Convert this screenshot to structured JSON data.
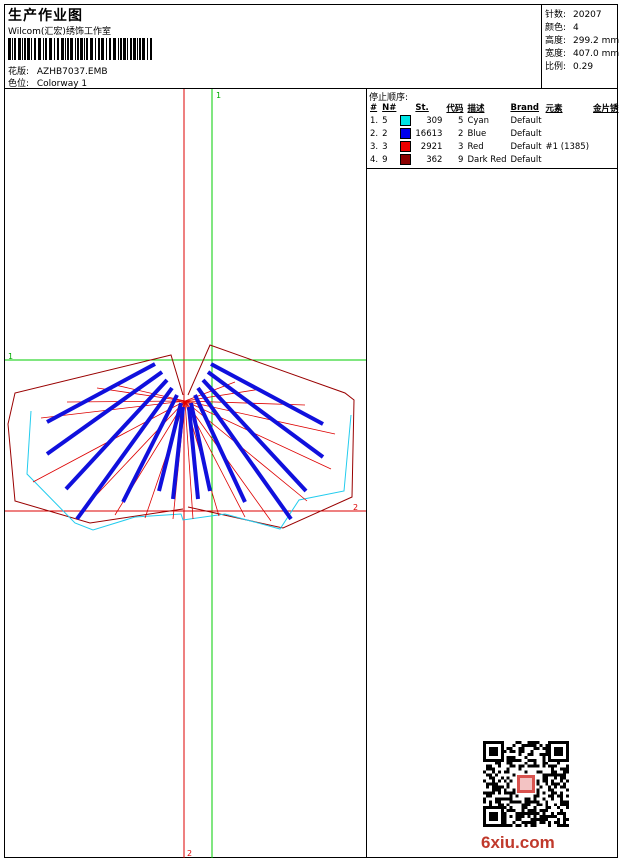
{
  "header": {
    "title": "生产作业图",
    "studio": "Wilcom(汇宏)绣饰工作室",
    "design_label": "花版:",
    "design_value": "AZHB7037.EMB",
    "colorway_label": "色位:",
    "colorway_value": "Colorway 1"
  },
  "specs": [
    {
      "label": "针数:",
      "value": "20207"
    },
    {
      "label": "颜色:",
      "value": "4"
    },
    {
      "label": "高度:",
      "value": "299.2 mm"
    },
    {
      "label": "宽度:",
      "value": "407.0 mm"
    },
    {
      "label": "比例:",
      "value": "0.29"
    }
  ],
  "stop_sequence": {
    "title": "停止顺序:",
    "columns": [
      "#",
      "N#",
      "St.",
      "代码",
      "描述",
      "Brand",
      "元素",
      "金片锈"
    ],
    "rows": [
      {
        "seq": "1.",
        "n": "5",
        "color": "#00e5e5",
        "stitches": "309",
        "code": "5",
        "desc": "Cyan",
        "brand": "Default",
        "element": "",
        "sequin": ""
      },
      {
        "seq": "2.",
        "n": "2",
        "color": "#0000ee",
        "stitches": "16613",
        "code": "2",
        "desc": "Blue",
        "brand": "Default",
        "element": "",
        "sequin": ""
      },
      {
        "seq": "3.",
        "n": "3",
        "color": "#ee0000",
        "stitches": "2921",
        "code": "3",
        "desc": "Red",
        "brand": "Default",
        "element": "#1 (1385)",
        "sequin": ""
      },
      {
        "seq": "4.",
        "n": "9",
        "color": "#8b0000",
        "stitches": "362",
        "code": "9",
        "desc": "Dark Red",
        "brand": "Default",
        "element": "",
        "sequin": ""
      }
    ]
  },
  "axis_labels": {
    "top": "1",
    "left": "1",
    "right": "2",
    "bottom": "2"
  },
  "watermark": "6xiu.com",
  "colors": {
    "guide_green": "#00cc00",
    "guide_red": "#dd0000",
    "stitch_blue": "#1010dd",
    "cyan": "#22ccee",
    "dark_red": "#990000"
  }
}
